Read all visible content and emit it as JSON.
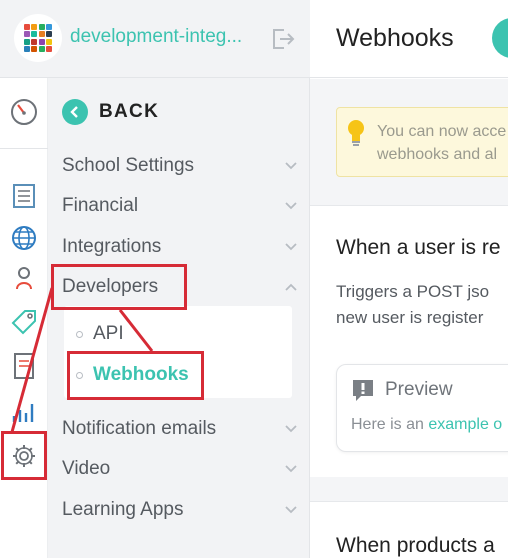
{
  "app": {
    "title": "development-integ...",
    "accent_color": "#3cc3b0",
    "logo_icon": "grid-logo-icon",
    "logout_icon": "logout-icon"
  },
  "icon_rail": {
    "icons": [
      "dashboard-gauge-icon",
      "pages-icon",
      "globe-icon",
      "users-icon",
      "tags-icon",
      "reports-icon",
      "analytics-icon",
      "gear-icon"
    ],
    "active": "gear-icon"
  },
  "submenu": {
    "back_label": "BACK",
    "items": [
      {
        "label": "School Settings",
        "expanded": false
      },
      {
        "label": "Financial",
        "expanded": false
      },
      {
        "label": "Integrations",
        "expanded": false
      },
      {
        "label": "Developers",
        "expanded": true
      },
      {
        "label": "Notification emails",
        "expanded": false
      },
      {
        "label": "Video",
        "expanded": false
      },
      {
        "label": "Learning Apps",
        "expanded": false
      }
    ],
    "developer_children": [
      {
        "label": "API",
        "active": false
      },
      {
        "label": "Webhooks",
        "active": true
      }
    ]
  },
  "main": {
    "page_title": "Webhooks",
    "info_line1": "You can now acce",
    "info_line2": "webhooks and al",
    "card1": {
      "title": "When a user is re",
      "desc_line1": "Triggers a POST jso",
      "desc_line2": "new user is register",
      "preview_title": "Preview",
      "preview_text": "Here is an ",
      "preview_link": "example o"
    },
    "card2": {
      "title": "When products a"
    }
  },
  "annotation_color": "#d62b36"
}
